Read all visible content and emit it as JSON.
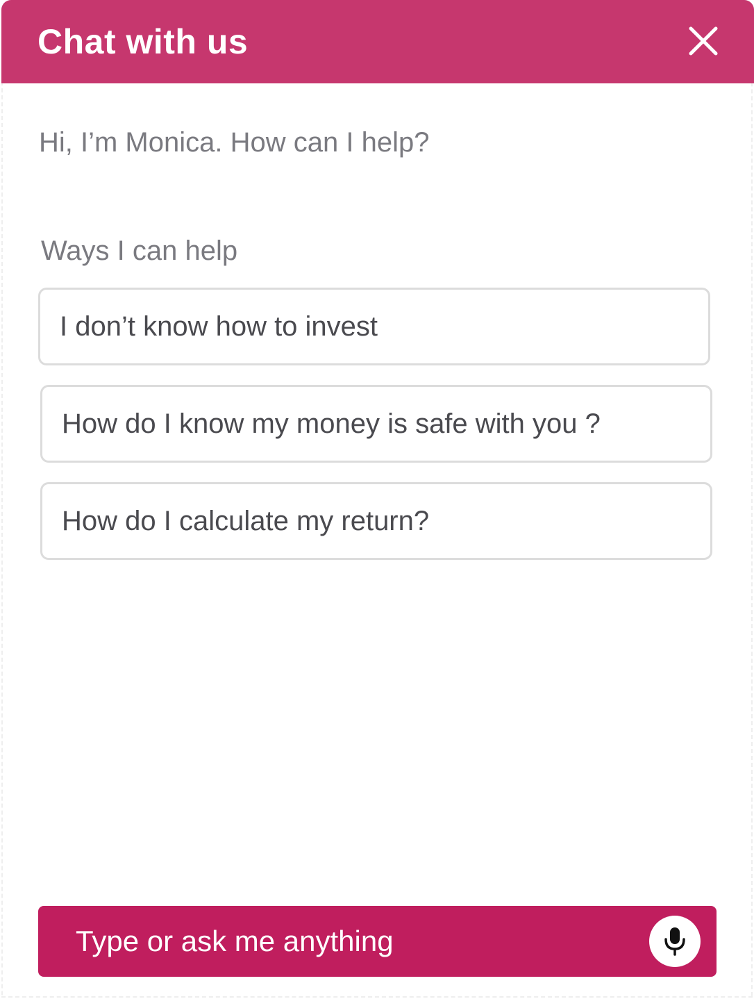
{
  "header": {
    "title": "Chat with us",
    "close_icon": "close-icon"
  },
  "main": {
    "greeting": "Hi, I’m Monica. How can I help?",
    "ways_label": "Ways I can help",
    "suggestions": [
      "I don’t know how to invest",
      "How do I know my money is safe with you ?",
      "How do I calculate my return?"
    ]
  },
  "input": {
    "placeholder": "Type or ask me anything",
    "value": "",
    "mic_icon": "microphone-icon"
  },
  "colors": {
    "header_bg": "#c6376e",
    "input_bg": "#c01e5e",
    "text_muted": "#7a7a80",
    "text_dark": "#4a4a4f",
    "border": "#dcdcdc"
  }
}
